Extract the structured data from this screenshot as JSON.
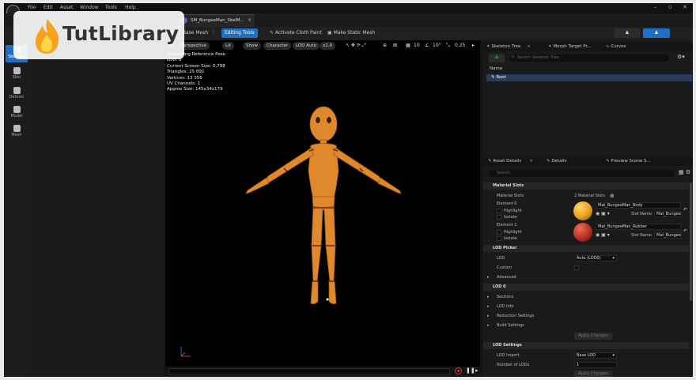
{
  "watermark": {
    "text": "TutLibrary"
  },
  "menu": [
    "File",
    "Edit",
    "Asset",
    "Window",
    "Tools",
    "Help"
  ],
  "tab": {
    "title": "SM_BungeeMan_SkelM...",
    "close": "×"
  },
  "toolbar": {
    "base_mesh": "Import Base Mesh",
    "editing_tools": "Editing Tools",
    "cloth_paint": "Activate Cloth Paint",
    "static_mesh": "Make Static Mesh"
  },
  "modes": [
    "Skeleton",
    "Skin",
    "Deform",
    "Model",
    "Mesh"
  ],
  "viewport": {
    "buttons": [
      "Perspective",
      "Lit",
      "Show",
      "Character",
      "LOD Auto",
      "x1.0"
    ],
    "snap": [
      "10",
      "10°",
      "0.25"
    ],
    "stats": [
      "Previewing Reference Pose",
      "LOD: 0",
      "Current Screen Size: 0,798",
      "Triangles: 25 892",
      "Vertices: 13 356",
      "UV Channels: 1",
      "Approx Size: 145x34x179"
    ]
  },
  "skeleton_tree": {
    "tabs": [
      "Skeleton Tree",
      "Morph Target Pr...",
      "Curves"
    ],
    "search_placeholder": "Search Skeleton Tree...",
    "column": "Name",
    "root": "Root"
  },
  "details": {
    "tabs": [
      "Asset Details",
      "Details",
      "Preview Scene S..."
    ],
    "search_placeholder": "Search",
    "material_slots_header": "Material Slots",
    "material_slots_label": "Material Slots",
    "material_slots_value": "2 Material Slots",
    "elements": [
      {
        "name": "Element 0",
        "material": "Mat_BungeeMan_Body",
        "slot": "Mat_BungeeM",
        "color": "#e8a21c"
      },
      {
        "name": "Element 1",
        "material": "Mat_BungeeMan_Rubber",
        "slot": "Mat_BungeeM",
        "color": "#b83020"
      }
    ],
    "highlight": "Highlight",
    "isolate": "Isolate",
    "slot_name": "Slot Name",
    "lod_picker_header": "LOD Picker",
    "lod_label": "LOD",
    "lod_value": "Auto (LOD0)",
    "custom": "Custom",
    "advanced": "Advanced",
    "lod0_header": "LOD 0",
    "lod0_items": [
      "Sections",
      "LOD Info",
      "Reduction Settings",
      "Build Settings"
    ],
    "apply_changes": "Apply Changes",
    "lod_settings_header": "LOD Settings",
    "lod_import_label": "LOD Import",
    "lod_import_value": "Base LOD",
    "num_lods_label": "Number of LODs",
    "num_lods_value": "1"
  },
  "colors": {
    "accent": "#1f6fc4",
    "character": "#e0892c"
  }
}
